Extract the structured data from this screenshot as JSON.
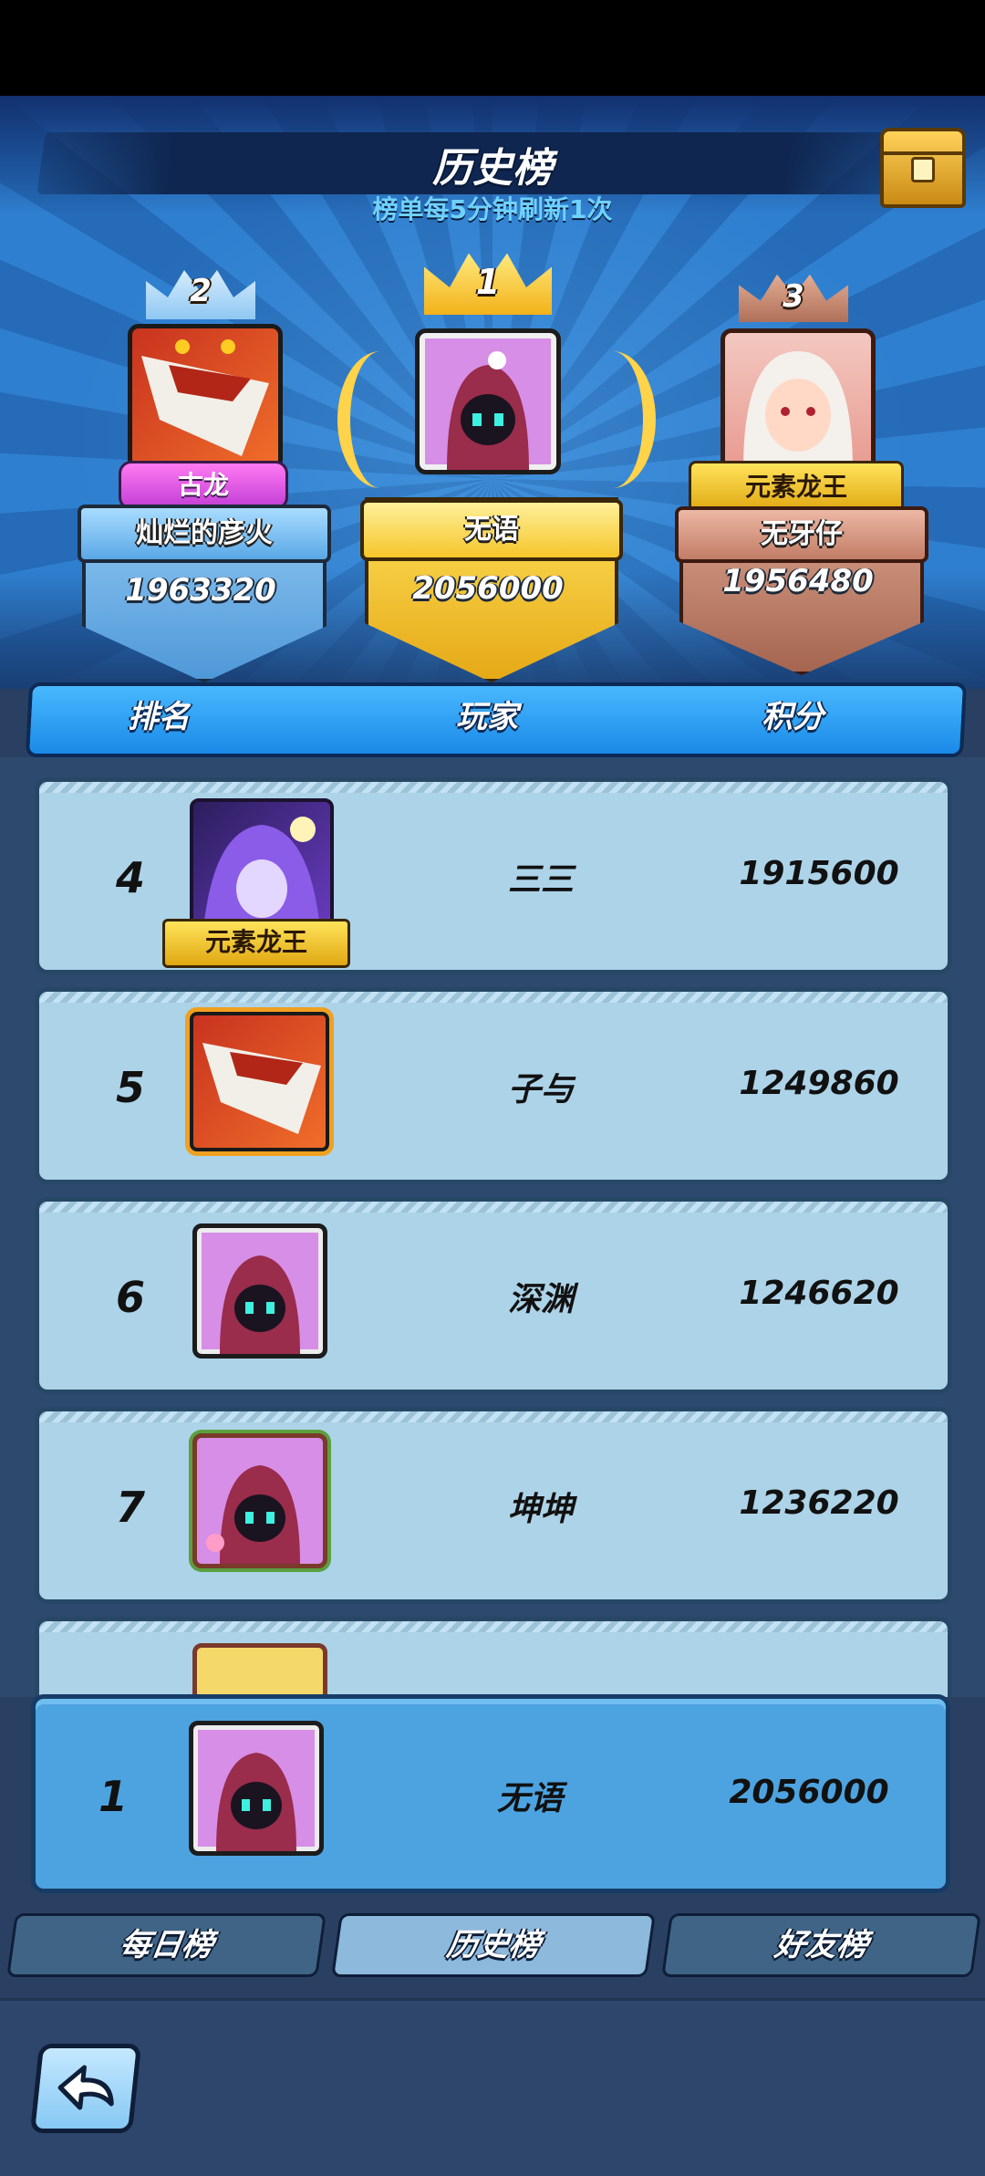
{
  "header": {
    "title": "历史榜",
    "subtitle": "榜单每5分钟刷新1次"
  },
  "podium": [
    {
      "rank": "2",
      "title_badge": "古龙",
      "name": "灿烂的彦火",
      "score": "1963320"
    },
    {
      "rank": "1",
      "title_badge": "",
      "name": "无语",
      "score": "2056000"
    },
    {
      "rank": "3",
      "title_badge": "元素龙王",
      "name": "无牙仔",
      "score": "1956480"
    }
  ],
  "columns": {
    "rank": "排名",
    "player": "玩家",
    "score": "积分"
  },
  "rows": [
    {
      "rank": "4",
      "name": "三三",
      "score": "1915600",
      "badge": "元素龙王"
    },
    {
      "rank": "5",
      "name": "子与",
      "score": "1249860",
      "badge": ""
    },
    {
      "rank": "6",
      "name": "深渊",
      "score": "1246620",
      "badge": ""
    },
    {
      "rank": "7",
      "name": "坤坤",
      "score": "1236220",
      "badge": ""
    }
  ],
  "my_row": {
    "rank": "1",
    "name": "无语",
    "score": "2056000"
  },
  "tabs": {
    "daily": "每日榜",
    "history": "历史榜",
    "friends": "好友榜"
  },
  "colors": {
    "gold": "#ffd34a",
    "silver_blue": "#8fc7f2",
    "bronze": "#c98a73",
    "row_bg": "#add3e8",
    "my_row_bg": "#4da3e0"
  }
}
